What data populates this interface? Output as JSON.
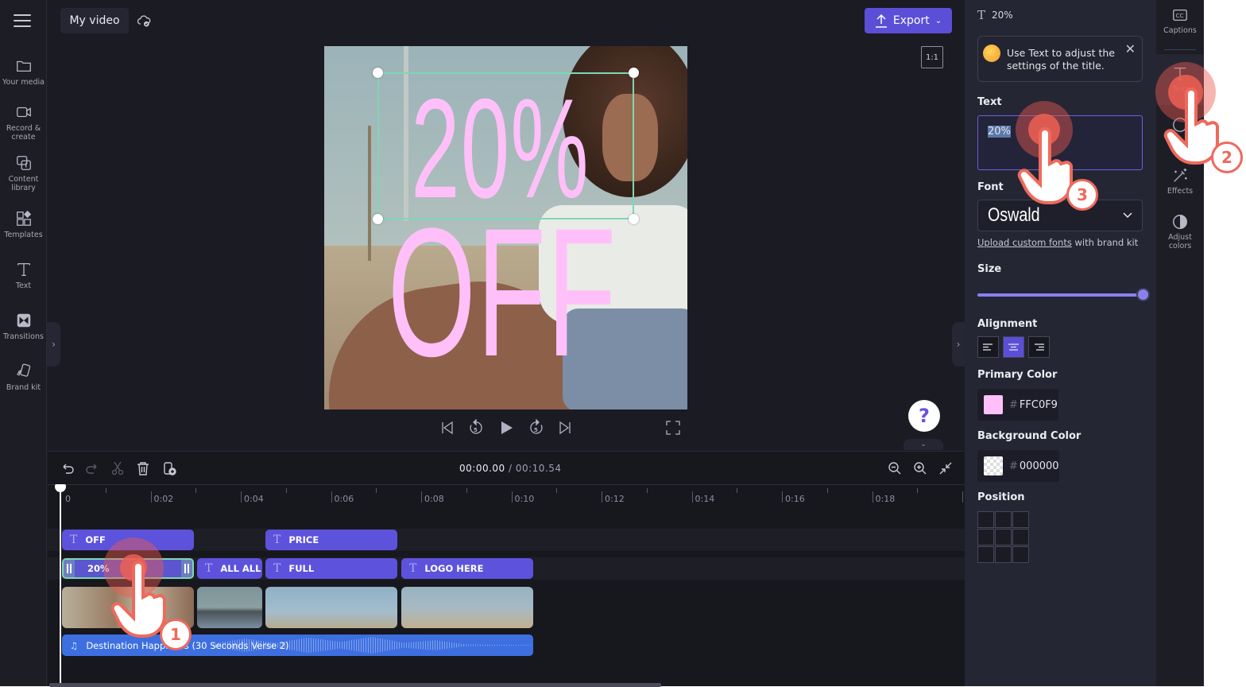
{
  "app": {
    "project_title": "My video"
  },
  "sidebar": {
    "items": [
      {
        "label": "Your media"
      },
      {
        "label": "Record &\ncreate"
      },
      {
        "label": "Content\nlibrary"
      },
      {
        "label": "Templates"
      },
      {
        "label": "Text"
      },
      {
        "label": "Transitions"
      },
      {
        "label": "Brand kit"
      }
    ]
  },
  "toolbar": {
    "export_label": "Export",
    "aspect_ratio": "1:1"
  },
  "preview": {
    "line1": "20%",
    "line2": "OFF",
    "text_color": "#FFC0F9"
  },
  "help": {
    "label": "?"
  },
  "timeline": {
    "current_time": "00:00.00",
    "total_time": "/ 00:10.54",
    "ruler": [
      "0",
      "0:02",
      "0:04",
      "0:06",
      "0:08",
      "0:10",
      "0:12",
      "0:14",
      "0:16",
      "0:18"
    ],
    "text_clips_row1": [
      "OFF",
      "PRICE"
    ],
    "text_clips_row2": [
      "20%",
      "ALL ALL A",
      "FULL",
      "LOGO HERE"
    ],
    "audio_clip": "Destination Happiness (30 Seconds Verse 2)"
  },
  "props": {
    "header_title": "20%",
    "tip_message": "Use Text to adjust the settings of the title.",
    "text_label": "Text",
    "text_value": "20%",
    "font_label": "Font",
    "font_value": "Oswald",
    "upload_link": "Upload custom fonts",
    "upload_suffix": " with brand kit",
    "size_label": "Size",
    "size_value_percent": 100,
    "alignment_label": "Alignment",
    "alignment_selected": "center",
    "primary_color_label": "Primary Color",
    "primary_color_hash": "#",
    "primary_color_value": "FFC0F9",
    "primary_color_hex": "#FFC0F9",
    "background_color_label": "Background Color",
    "background_color_hash": "#",
    "background_color_value": "000000",
    "position_label": "Position"
  },
  "rail": {
    "items": [
      {
        "label": "Captions"
      },
      {
        "label": "Text"
      },
      {
        "label": "Effects"
      },
      {
        "label": "Adjust\ncolors"
      }
    ]
  },
  "tutorial": {
    "steps": [
      "1",
      "2",
      "3"
    ]
  }
}
